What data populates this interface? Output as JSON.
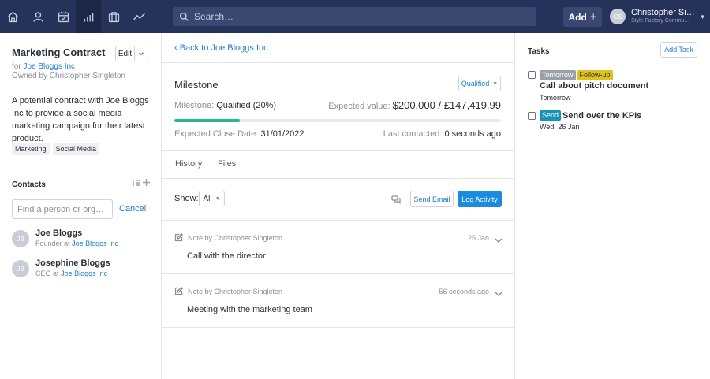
{
  "nav": {
    "items": [
      {
        "name": "home-icon"
      },
      {
        "name": "person-icon"
      },
      {
        "name": "calendar-icon"
      },
      {
        "name": "bars-icon",
        "active": true
      },
      {
        "name": "briefcase-icon"
      },
      {
        "name": "trend-icon"
      }
    ],
    "search_placeholder": "Search…",
    "add_label": "Add",
    "add_icon": "+",
    "user_initials": "CS",
    "user_name": "Christopher Si…",
    "user_org": "Style Factory Commu…"
  },
  "lead": {
    "title": "Marketing Contract",
    "edit_label": "Edit",
    "for_prefix": "for",
    "for_company": "Joe Bloggs Inc",
    "owned_by": "Owned by Christopher Singleton",
    "description": "A potential contract with Joe Bloggs Inc to provide a social media marketing campaign for their latest product.",
    "tags": [
      "Marketing",
      "Social Media"
    ]
  },
  "contacts": {
    "heading": "Contacts",
    "find_placeholder": "Find a person or org…",
    "cancel_label": "Cancel",
    "list": [
      {
        "initials": "JB",
        "name": "Joe Bloggs",
        "role": "Founder",
        "at": "at",
        "company": "Joe Bloggs Inc"
      },
      {
        "initials": "JB",
        "name": "Josephine Bloggs",
        "role": "CEO",
        "at": "at",
        "company": "Joe Bloggs Inc"
      }
    ]
  },
  "opportunity": {
    "back_label": "‹ Back to Joe Bloggs Inc",
    "milestone_title": "Milestone",
    "milestone_button": "Qualified",
    "milestone_label": "Milestone:",
    "milestone_value": "Qualified (20%)",
    "progress_pct": 20,
    "expected_value_label": "Expected value:",
    "expected_value": "$200,000 / £147,419.99",
    "close_date_label": "Expected Close Date:",
    "close_date": "31/01/2022",
    "last_contacted_label": "Last contacted:",
    "last_contacted": "0 seconds ago",
    "tabs": [
      "History",
      "Files"
    ],
    "show_label": "Show:",
    "show_value": "All",
    "send_email_label": "Send Email",
    "log_activity_label": "Log Activity",
    "notes": [
      {
        "meta": "Note by Christopher Singleton",
        "date": "25 Jan",
        "body": "Call with the director"
      },
      {
        "meta": "Note by Christopher Singleton",
        "date": "56 seconds ago",
        "body": "Meeting with the marketing team"
      }
    ]
  },
  "tasks": {
    "heading": "Tasks",
    "add_label": "Add Task",
    "items": [
      {
        "badges": [
          {
            "text": "Tomorrow",
            "color": "#9aa0aa"
          },
          {
            "text": "Follow-up",
            "color": "#e0c21a"
          }
        ],
        "title": "Call about pitch document",
        "due": "Tomorrow"
      },
      {
        "badges": [
          {
            "text": "Send",
            "color": "#1793b5"
          }
        ],
        "title": "Send over the KPIs",
        "due": "Wed, 26 Jan"
      }
    ]
  },
  "colors": {
    "topbar": "#253259",
    "link": "#1e7cc8",
    "primary": "#1a8be0",
    "progress": "#2db58e"
  }
}
